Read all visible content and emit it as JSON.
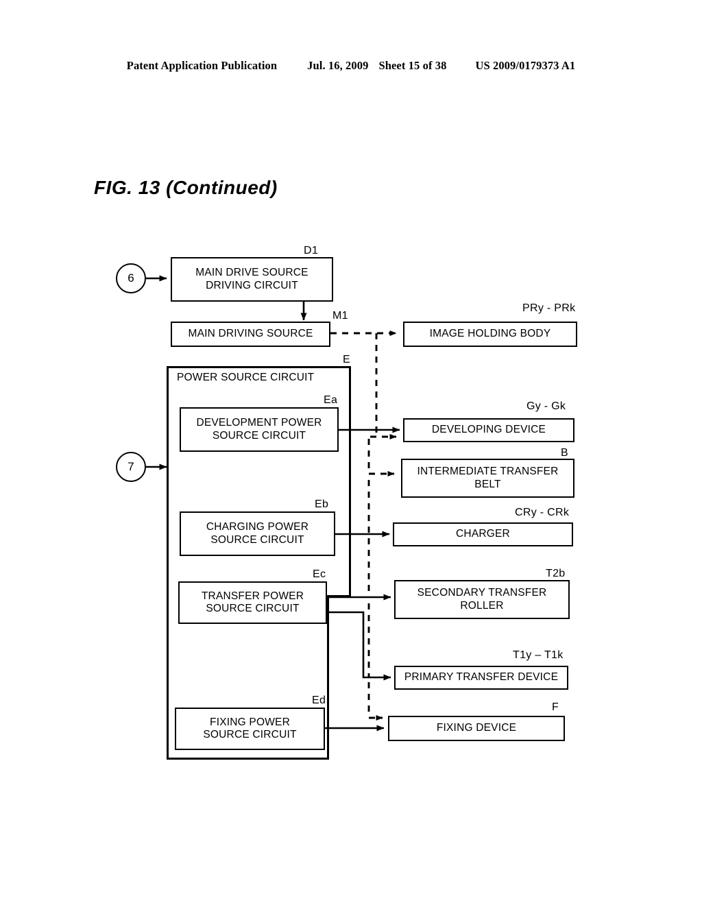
{
  "header": {
    "publication": "Patent Application Publication",
    "date": "Jul. 16, 2009",
    "sheet": "Sheet 15 of 38",
    "patent_number": "US 2009/0179373 A1"
  },
  "figure": {
    "title": "FIG. 13 (Continued)"
  },
  "diagram": {
    "circles": [
      {
        "id": "circle-6",
        "label": "6"
      },
      {
        "id": "circle-7",
        "label": "7"
      }
    ],
    "group": {
      "ref": "E",
      "title": "POWER SOURCE CIRCUIT"
    },
    "boxes": [
      {
        "id": "main-drive-source-driving-circuit",
        "ref": "D1",
        "label": "MAIN DRIVE SOURCE\nDRIVING CIRCUIT",
        "line1": "MAIN DRIVE SOURCE",
        "line2": "DRIVING CIRCUIT"
      },
      {
        "id": "main-driving-source",
        "ref": "M1",
        "label": "MAIN DRIVING SOURCE",
        "line1": "MAIN DRIVING SOURCE",
        "line2": ""
      },
      {
        "id": "image-holding-body",
        "ref": "PRy - PRk",
        "label": "IMAGE HOLDING BODY",
        "line1": "IMAGE HOLDING BODY",
        "line2": ""
      },
      {
        "id": "development-power-source-circuit",
        "ref": "Ea",
        "label": "DEVELOPMENT POWER\nSOURCE CIRCUIT",
        "line1": "DEVELOPMENT POWER",
        "line2": "SOURCE CIRCUIT"
      },
      {
        "id": "developing-device",
        "ref": "Gy - Gk",
        "label": "DEVELOPING DEVICE",
        "line1": "DEVELOPING DEVICE",
        "line2": ""
      },
      {
        "id": "intermediate-transfer-belt",
        "ref": "B",
        "label": "INTERMEDIATE TRANSFER\nBELT",
        "line1": "INTERMEDIATE TRANSFER",
        "line2": "BELT"
      },
      {
        "id": "charging-power-source-circuit",
        "ref": "Eb",
        "label": "CHARGING POWER\nSOURCE CIRCUIT",
        "line1": "CHARGING POWER",
        "line2": "SOURCE CIRCUIT"
      },
      {
        "id": "charger",
        "ref": "CRy - CRk",
        "label": "CHARGER",
        "line1": "CHARGER",
        "line2": ""
      },
      {
        "id": "transfer-power-source-circuit",
        "ref": "Ec",
        "label": "TRANSFER POWER\nSOURCE CIRCUIT",
        "line1": "TRANSFER POWER",
        "line2": "SOURCE CIRCUIT"
      },
      {
        "id": "secondary-transfer-roller",
        "ref": "T2b",
        "label": "SECONDARY TRANSFER\nROLLER",
        "line1": "SECONDARY TRANSFER",
        "line2": "ROLLER"
      },
      {
        "id": "primary-transfer-device",
        "ref": "T1y – T1k",
        "label": "PRIMARY TRANSFER DEVICE",
        "line1": "PRIMARY TRANSFER DEVICE",
        "line2": ""
      },
      {
        "id": "fixing-power-source-circuit",
        "ref": "Ed",
        "label": "FIXING POWER\nSOURCE CIRCUIT",
        "line1": "FIXING POWER",
        "line2": "SOURCE CIRCUIT"
      },
      {
        "id": "fixing-device",
        "ref": "F",
        "label": "FIXING DEVICE",
        "line1": "FIXING DEVICE",
        "line2": ""
      }
    ],
    "connections": [
      {
        "from": "circle-6",
        "to": "main-drive-source-driving-circuit",
        "style": "solid"
      },
      {
        "from": "main-drive-source-driving-circuit",
        "to": "main-driving-source",
        "style": "solid"
      },
      {
        "from": "main-driving-source",
        "to": "image-holding-body",
        "style": "dashed"
      },
      {
        "from": "main-driving-source",
        "to": "developing-device",
        "style": "dashed"
      },
      {
        "from": "main-driving-source",
        "to": "intermediate-transfer-belt",
        "style": "dashed"
      },
      {
        "from": "main-driving-source",
        "to": "fixing-device",
        "style": "dashed"
      },
      {
        "from": "circle-7",
        "to": "group-E",
        "style": "solid"
      },
      {
        "from": "development-power-source-circuit",
        "to": "developing-device",
        "style": "solid"
      },
      {
        "from": "charging-power-source-circuit",
        "to": "charger",
        "style": "solid"
      },
      {
        "from": "transfer-power-source-circuit",
        "to": "secondary-transfer-roller",
        "style": "solid"
      },
      {
        "from": "transfer-power-source-circuit",
        "to": "primary-transfer-device",
        "style": "solid"
      },
      {
        "from": "fixing-power-source-circuit",
        "to": "fixing-device",
        "style": "solid"
      }
    ],
    "colors": {
      "ink": "#000000",
      "paper": "#ffffff"
    }
  }
}
